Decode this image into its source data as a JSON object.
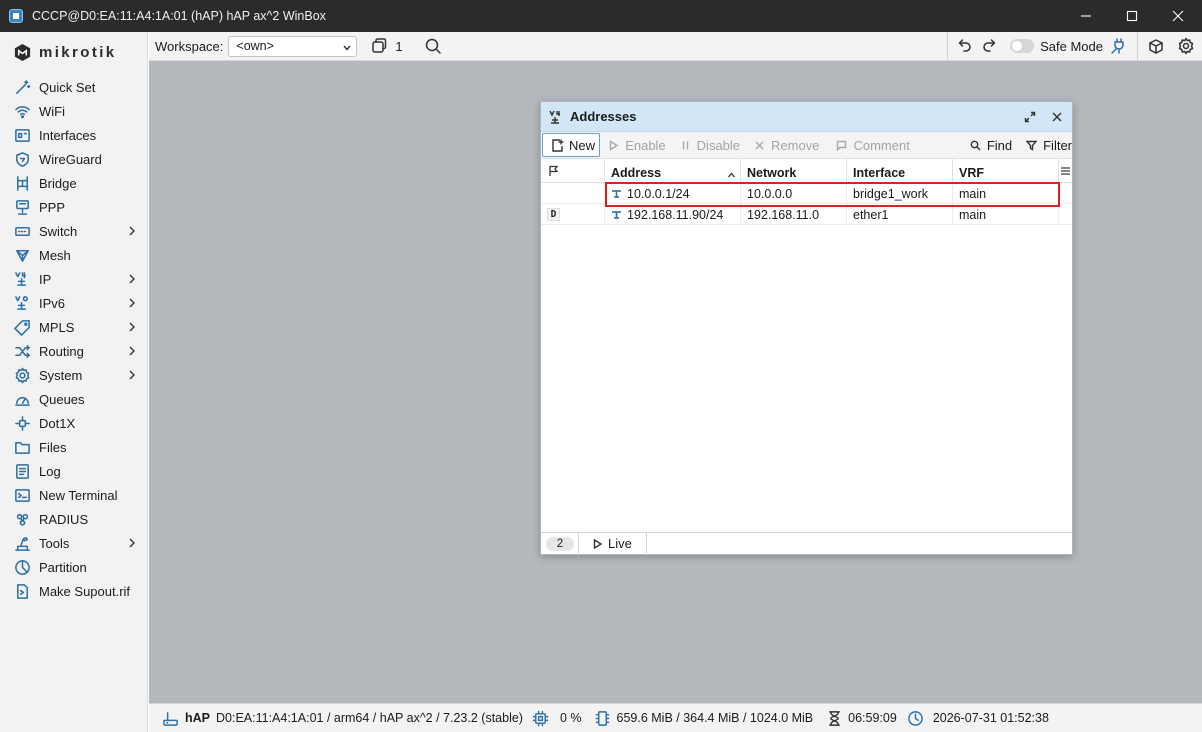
{
  "window": {
    "title": "CCCP@D0:EA:11:A4:1A:01 (hAP) hAP ax^2 WinBox"
  },
  "brand": {
    "logo_text": "mikrotik"
  },
  "sidebar": {
    "items": [
      {
        "label": "Quick Set",
        "icon": "magic-wand-icon",
        "submenu": false
      },
      {
        "label": "WiFi",
        "icon": "wifi-icon",
        "submenu": false
      },
      {
        "label": "Interfaces",
        "icon": "interfaces-icon",
        "submenu": false
      },
      {
        "label": "WireGuard",
        "icon": "wireguard-shield-icon",
        "submenu": false
      },
      {
        "label": "Bridge",
        "icon": "bridge-icon",
        "submenu": false
      },
      {
        "label": "PPP",
        "icon": "ppp-icon",
        "submenu": false
      },
      {
        "label": "Switch",
        "icon": "switch-icon",
        "submenu": true
      },
      {
        "label": "Mesh",
        "icon": "mesh-icon",
        "submenu": false
      },
      {
        "label": "IP",
        "icon": "ip-icon",
        "submenu": true
      },
      {
        "label": "IPv6",
        "icon": "ipv6-icon",
        "submenu": true
      },
      {
        "label": "MPLS",
        "icon": "tag-icon",
        "submenu": true
      },
      {
        "label": "Routing",
        "icon": "routing-icon",
        "submenu": true
      },
      {
        "label": "System",
        "icon": "gear-icon",
        "submenu": true
      },
      {
        "label": "Queues",
        "icon": "gauge-icon",
        "submenu": false
      },
      {
        "label": "Dot1X",
        "icon": "dot1x-icon",
        "submenu": false
      },
      {
        "label": "Files",
        "icon": "folder-icon",
        "submenu": false
      },
      {
        "label": "Log",
        "icon": "log-icon",
        "submenu": false
      },
      {
        "label": "New Terminal",
        "icon": "terminal-icon",
        "submenu": false
      },
      {
        "label": "RADIUS",
        "icon": "radius-icon",
        "submenu": false
      },
      {
        "label": "Tools",
        "icon": "tools-icon",
        "submenu": true
      },
      {
        "label": "Partition",
        "icon": "partition-icon",
        "submenu": false
      },
      {
        "label": "Make Supout.rif",
        "icon": "supout-icon",
        "submenu": false
      }
    ]
  },
  "toolbar": {
    "workspace_label": "Workspace:",
    "workspace_value": "<own>",
    "windows_count": "1",
    "safe_mode_label": "Safe Mode"
  },
  "addresses": {
    "title": "Addresses",
    "buttons": {
      "new": "New",
      "enable": "Enable",
      "disable": "Disable",
      "remove": "Remove",
      "comment": "Comment",
      "find": "Find",
      "filter": "Filter"
    },
    "columns": [
      "Address",
      "Network",
      "Interface",
      "VRF"
    ],
    "rows": [
      {
        "flag": "",
        "address": "10.0.0.1/24",
        "network": "10.0.0.0",
        "interface": "bridge1_work",
        "vrf": "main",
        "highlighted": true
      },
      {
        "flag": "D",
        "address": "192.168.11.90/24",
        "network": "192.168.11.0",
        "interface": "ether1",
        "vrf": "main",
        "highlighted": false
      }
    ],
    "footer": {
      "count": "2",
      "live_label": "Live"
    }
  },
  "status": {
    "device": "hAP",
    "info": "D0:EA:11:A4:1A:01 / arm64 / hAP ax^2 / 7.23.2 (stable)",
    "cpu": "0 %",
    "memory": "659.6 MiB / 364.4 MiB / 1024.0 MiB",
    "uptime": "06:59:09",
    "datetime": "2026-07-31 01:52:38"
  },
  "colors": {
    "accent": "#2d6fa6",
    "titlebar": "#2b2b2b",
    "workspace_bg": "#b5b8bc",
    "window_title_bg": "#d3e6f7",
    "highlight_border": "#d6232a"
  }
}
